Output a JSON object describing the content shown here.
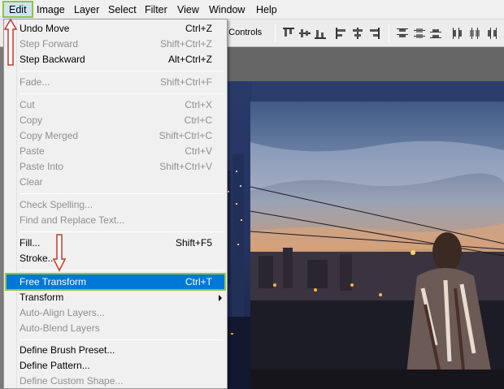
{
  "menubar": {
    "items": [
      "Edit",
      "Image",
      "Layer",
      "Select",
      "Filter",
      "View",
      "Window",
      "Help"
    ]
  },
  "options_bar": {
    "controls_label": "n Controls"
  },
  "edit_menu": {
    "groups": [
      [
        {
          "label": "Undo Move",
          "shortcut": "Ctrl+Z",
          "enabled": true
        },
        {
          "label": "Step Forward",
          "shortcut": "Shift+Ctrl+Z",
          "enabled": false
        },
        {
          "label": "Step Backward",
          "shortcut": "Alt+Ctrl+Z",
          "enabled": true
        }
      ],
      [
        {
          "label": "Fade...",
          "shortcut": "Shift+Ctrl+F",
          "enabled": false
        }
      ],
      [
        {
          "label": "Cut",
          "shortcut": "Ctrl+X",
          "enabled": false
        },
        {
          "label": "Copy",
          "shortcut": "Ctrl+C",
          "enabled": false
        },
        {
          "label": "Copy Merged",
          "shortcut": "Shift+Ctrl+C",
          "enabled": false
        },
        {
          "label": "Paste",
          "shortcut": "Ctrl+V",
          "enabled": false
        },
        {
          "label": "Paste Into",
          "shortcut": "Shift+Ctrl+V",
          "enabled": false
        },
        {
          "label": "Clear",
          "shortcut": "",
          "enabled": false
        }
      ],
      [
        {
          "label": "Check Spelling...",
          "shortcut": "",
          "enabled": false
        },
        {
          "label": "Find and Replace Text...",
          "shortcut": "",
          "enabled": false
        }
      ],
      [
        {
          "label": "Fill...",
          "shortcut": "Shift+F5",
          "enabled": true
        },
        {
          "label": "Stroke...",
          "shortcut": "",
          "enabled": true
        }
      ],
      [
        {
          "label": "Free Transform",
          "shortcut": "Ctrl+T",
          "enabled": true,
          "highlighted": true
        },
        {
          "label": "Transform",
          "shortcut": "",
          "enabled": true,
          "submenu": true
        },
        {
          "label": "Auto-Align Layers...",
          "shortcut": "",
          "enabled": false
        },
        {
          "label": "Auto-Blend Layers",
          "shortcut": "",
          "enabled": false
        }
      ],
      [
        {
          "label": "Define Brush Preset...",
          "shortcut": "",
          "enabled": true
        },
        {
          "label": "Define Pattern...",
          "shortcut": "",
          "enabled": true
        },
        {
          "label": "Define Custom Shape...",
          "shortcut": "",
          "enabled": false
        }
      ]
    ]
  },
  "colors": {
    "highlight_bg": "#0078d7",
    "annotation_green": "#8dc63f",
    "annotation_arrow": "#c0392b"
  },
  "icons": [
    "align-top-icon",
    "align-vcenter-icon",
    "align-bottom-icon",
    "align-left-icon",
    "align-hcenter-icon",
    "align-right-icon",
    "distribute-top-icon",
    "distribute-vcenter-icon",
    "distribute-bottom-icon",
    "distribute-left-icon",
    "distribute-hcenter-icon",
    "distribute-right-icon"
  ]
}
